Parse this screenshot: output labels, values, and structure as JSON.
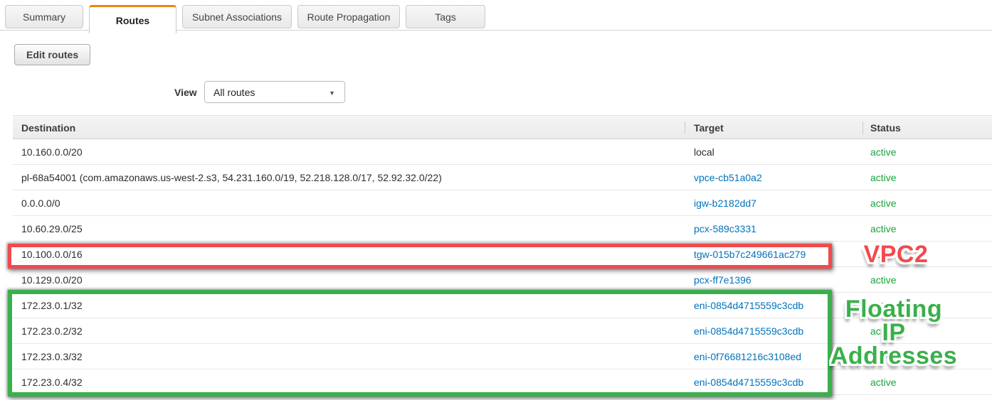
{
  "tabs": [
    {
      "label": "Summary",
      "active": false
    },
    {
      "label": "Routes",
      "active": true
    },
    {
      "label": "Subnet Associations",
      "active": false
    },
    {
      "label": "Route Propagation",
      "active": false
    },
    {
      "label": "Tags",
      "active": false
    }
  ],
  "toolbar": {
    "edit_routes_label": "Edit routes"
  },
  "filter": {
    "view_label": "View",
    "selected_option": "All routes",
    "caret_icon": "▼"
  },
  "table": {
    "columns": {
      "destination": "Destination",
      "target": "Target",
      "status": "Status"
    },
    "rows": [
      {
        "destination": "10.160.0.0/20",
        "target": "local",
        "status": "active"
      },
      {
        "destination": "pl-68a54001 (com.amazonaws.us-west-2.s3, 54.231.160.0/19, 52.218.128.0/17, 52.92.32.0/22)",
        "target": "vpce-cb51a0a2",
        "status": "active"
      },
      {
        "destination": "0.0.0.0/0",
        "target": "igw-b2182dd7",
        "status": "active"
      },
      {
        "destination": "10.60.29.0/25",
        "target": "pcx-589c3331",
        "status": "active"
      },
      {
        "destination": "10.100.0.0/16",
        "target": "tgw-015b7c249661ac279",
        "status": "active"
      },
      {
        "destination": "10.129.0.0/20",
        "target": "pcx-ff7e1396",
        "status": "active"
      },
      {
        "destination": "172.23.0.1/32",
        "target": "eni-0854d4715559c3cdb",
        "status": "active"
      },
      {
        "destination": "172.23.0.2/32",
        "target": "eni-0854d4715559c3cdb",
        "status": "active"
      },
      {
        "destination": "172.23.0.3/32",
        "target": "eni-0f76681216c3108ed",
        "status": "active"
      },
      {
        "destination": "172.23.0.4/32",
        "target": "eni-0854d4715559c3cdb",
        "status": "active"
      }
    ]
  },
  "annotations": {
    "red_box_label": "VPC2",
    "green_box_lines": {
      "line1": "Floating",
      "line2": "IP",
      "line3": "Addresses"
    },
    "red_color": "#f14a4e",
    "green_color": "#3ab04c"
  },
  "colors": {
    "link": "#0073bb",
    "status_active": "#18a43c",
    "active_tab_accent": "#e8870f"
  }
}
